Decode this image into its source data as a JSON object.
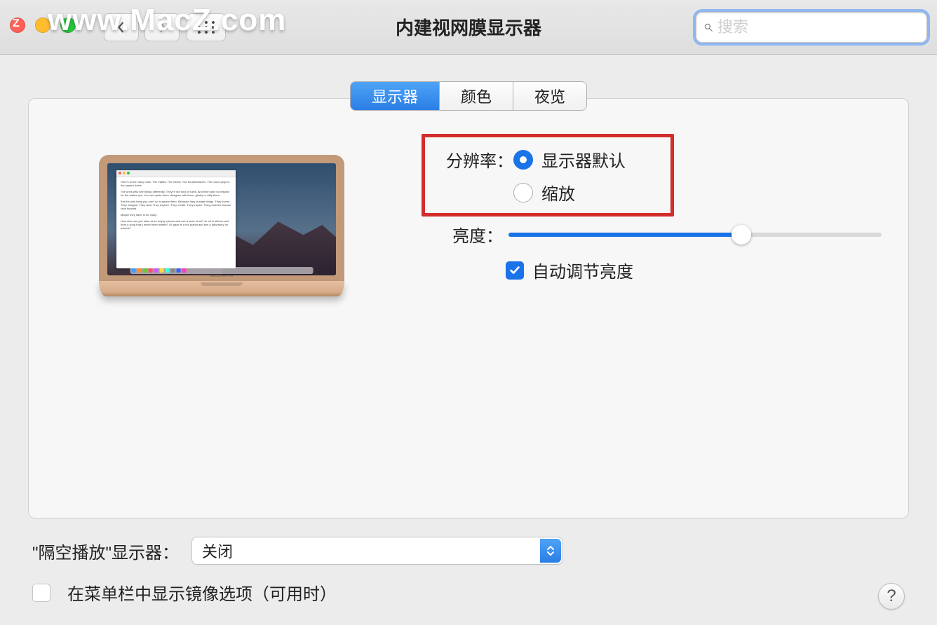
{
  "watermark": "www.MacZ.com",
  "header": {
    "title": "内建视网膜显示器",
    "search_placeholder": "搜索"
  },
  "tabs": {
    "display": "显示器",
    "color": "颜色",
    "night": "夜览"
  },
  "resolution": {
    "label": "分辨率：",
    "default": "显示器默认",
    "scaled": "缩放"
  },
  "brightness": {
    "label": "亮度：",
    "value_pct": 62,
    "auto": "自动调节亮度"
  },
  "airplay": {
    "label": "\"隔空播放\"显示器：",
    "value": "关闭"
  },
  "mirror": {
    "label": "在菜单栏中显示镜像选项（可用时）"
  },
  "laptop_model": "MacBook Air",
  "help": "?"
}
